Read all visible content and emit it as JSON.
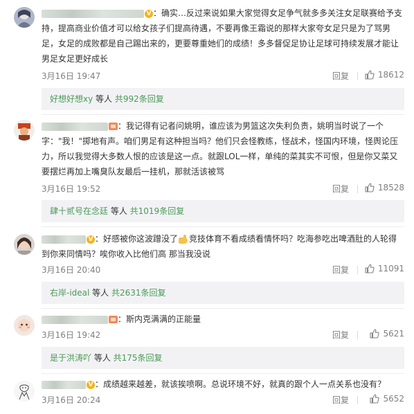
{
  "comments": [
    {
      "text": "：确实…反过来说如果大家觉得女足争气就多多关注女足联赛给予支持，提高商业价值才可以给女孩子们提高待遇，不要再像王霜说的那样大家夸女足只是为了骂男足，女足的成败都是自己踢出来的，更要尊重她们的成绩！多多督促足协让足球可持续发展才能让男足女足更好成长",
      "time": "3月16日 19:47",
      "reply": "回复",
      "likes": "18612",
      "sub_user": "好想好想xy",
      "sub_mid": " 等人 ",
      "sub_count": "共992条回复",
      "avatar": "anime-girl-avatar"
    },
    {
      "text": "：我记得有记者问姚明，谁应该为男篮这次失利负责，姚明当时说了一个字：\"我！\"掷地有声。咱们男足有这种担当吗？他们只会怪教练，怪战术，怪国内环境，怪舆论压力，所以我觉得大多数人恨的应该是这一点。就跟LOL一样，单纯的菜其实不可恨，但是你又菜又要摆烂再加上嘴臭队友最后一挂机，那就活该被骂",
      "time": "3月16日 19:52",
      "reply": "回复",
      "likes": "18528",
      "sub_user": "肆十贰号在念廷",
      "sub_mid": " 等人 ",
      "sub_count": "共1019条回复",
      "avatar": "character-avatar"
    },
    {
      "text_a": "：好感被你这波蹭没了",
      "text_b": "竞技体育不看成绩看情怀吗？吃海参吃出啤酒肚的人轮得到你来同情吗？唉你收入比他们高 那当我没说",
      "time": "3月16日 20:40",
      "reply": "回复",
      "likes": "11091",
      "sub_user": "右岸-ideal",
      "sub_mid": " 等人 ",
      "sub_count": "共2631条回复",
      "avatar": "girl-photo-avatar"
    },
    {
      "text": "：斯内克满满的正能量",
      "time": "3月16日 19:42",
      "reply": "回复",
      "likes": "5621",
      "sub_user": "是于洪涛吖",
      "sub_mid": " 等人 ",
      "sub_count": "共175条回复",
      "avatar": "cartoon-avatar"
    },
    {
      "text": "：成绩越来越差，就该挨喷啊。总说环境不好，就真的跟个人一点关系也没有？",
      "time": "3月16日 20:24",
      "reply": "回复",
      "likes": "5652",
      "avatar": "sketch-avatar"
    }
  ],
  "colors": {
    "text": "#333333",
    "meta": "#808080",
    "link_green": "#4a9b56",
    "sub_bg": "#f2f2f5",
    "badge_gold": "#f3b41b"
  },
  "icons": {
    "like": "thumbs-up-icon",
    "verified": "verified-badge-icon"
  }
}
